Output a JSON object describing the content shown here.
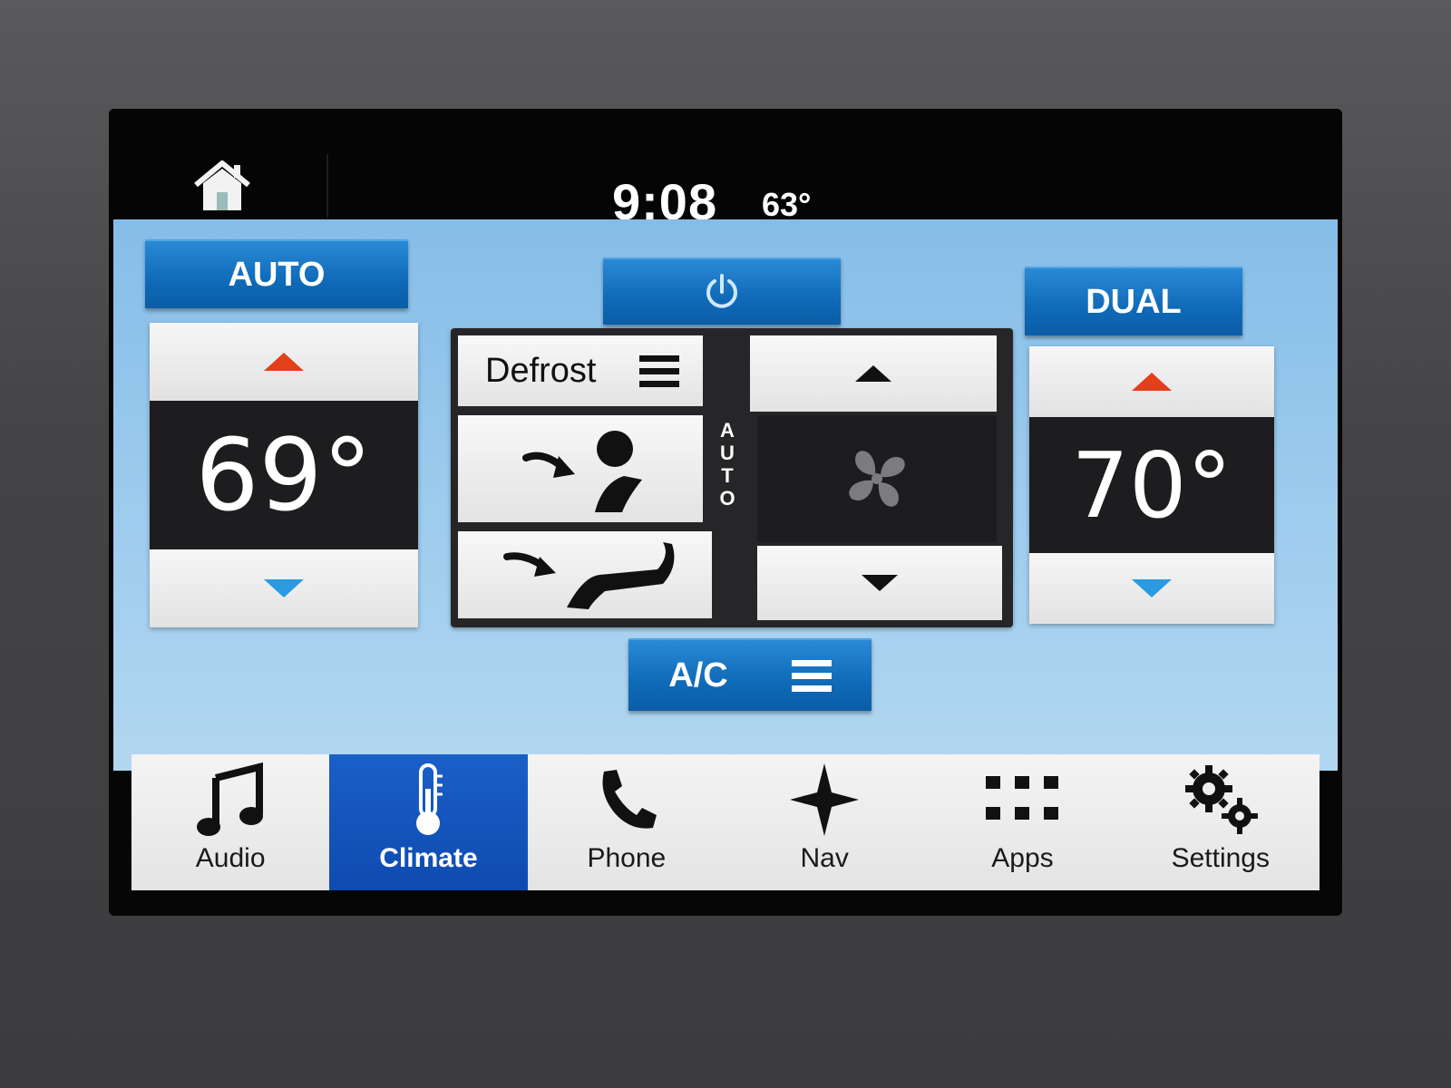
{
  "status_bar": {
    "time": "9:08",
    "outside_temp": "63°",
    "home_icon": "home-icon"
  },
  "climate": {
    "auto_label": "AUTO",
    "power_icon": "power-icon",
    "dual_label": "DUAL",
    "driver_temp": "69°",
    "passenger_temp": "70°",
    "defrost_label": "Defrost",
    "fan_auto_label": [
      "A",
      "U",
      "T",
      "O"
    ],
    "ac_label": "A/C",
    "colors": {
      "accent_blue": "#0f6ab8",
      "temp_up": "#e2401b",
      "temp_down": "#2a9be0",
      "panel_bg": "#9ccbed"
    }
  },
  "nav": {
    "items": [
      {
        "label": "Audio",
        "icon": "music-note-icon",
        "active": false
      },
      {
        "label": "Climate",
        "icon": "thermometer-icon",
        "active": true
      },
      {
        "label": "Phone",
        "icon": "phone-icon",
        "active": false
      },
      {
        "label": "Nav",
        "icon": "compass-star-icon",
        "active": false
      },
      {
        "label": "Apps",
        "icon": "apps-grid-icon",
        "active": false
      },
      {
        "label": "Settings",
        "icon": "gears-icon",
        "active": false
      }
    ]
  }
}
